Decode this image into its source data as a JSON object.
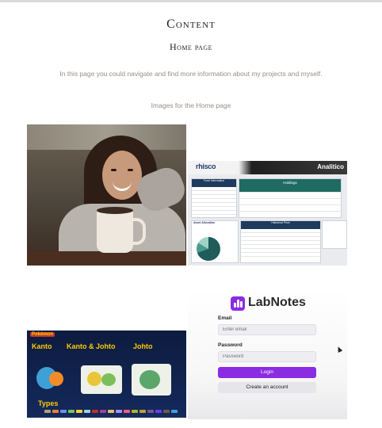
{
  "page": {
    "title": "Content",
    "subtitle": "Home page",
    "intro": "In this page you could navigate and find more information about my projects and myself.",
    "images_caption": "Images for the Home page"
  },
  "images": {
    "dashboard": {
      "logo": "rhisco",
      "brand": "Analitico",
      "fund_title": "Fund Information",
      "holdings_title": "Holdings",
      "allocation_title": "Asset Allocation",
      "historical_title": "Historical Price"
    },
    "pokemon": {
      "logo": "Pokémon",
      "labels": [
        "Kanto",
        "Kanto & Johto",
        "Johto"
      ],
      "types_label": "Types"
    },
    "labnotes": {
      "title": "LabNotes",
      "email_label": "Email",
      "email_placeholder": "Enter email",
      "password_label": "Password",
      "password_placeholder": "Password",
      "login_label": "Login",
      "create_label": "Create an account"
    }
  },
  "colors": {
    "caption_text": "#9a8d89",
    "labnotes_accent": "#8b2be2",
    "pokemon_yellow": "#ffcb05",
    "dashboard_navy": "#1e3a5c",
    "dashboard_teal": "#1f6b62"
  }
}
